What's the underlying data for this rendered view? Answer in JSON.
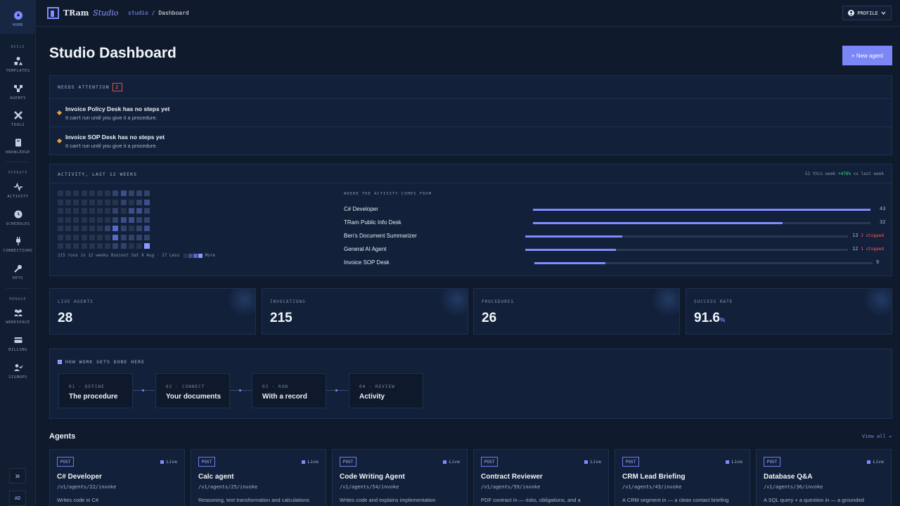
{
  "sidebar": {
    "home": "HOME",
    "groups": {
      "build": "BUILD",
      "operate": "OPERATE",
      "manage": "MANAGE"
    },
    "items": [
      "TEMPLATES",
      "AGENTS",
      "TOOLS",
      "KNOWLEDGE",
      "ACTIVITY",
      "SCHEDULES",
      "CONNECTIONS",
      "KEYS",
      "WORKSPACE",
      "BILLING",
      "SIGNUPS"
    ],
    "expand": "»",
    "avatar": "AD"
  },
  "topbar": {
    "brand_main": "TRam",
    "brand_sub": "Studio",
    "crumb_root": "studio",
    "crumb_sep": " / ",
    "crumb_current": "Dashboard",
    "profile": "PROFILE"
  },
  "page": {
    "title": "Studio Dashboard",
    "new_agent": "+ New agent"
  },
  "attention": {
    "heading": "NEEDS ATTENTION",
    "count": "2",
    "items": [
      {
        "title": "Invoice Policy Desk has no steps yet",
        "sub": "It can't run until you give it a procedure."
      },
      {
        "title": "Invoice SOP Desk has no steps yet",
        "sub": "It can't run until you give it a procedure."
      }
    ]
  },
  "activity": {
    "heading": "ACTIVITY, LAST 12 WEEKS",
    "week_summary_pre": "52 this week ",
    "week_delta": "+478%",
    "week_summary_post": " vs last week",
    "legend": "215 runs in 12 weeks   Busiest Sat 8 Aug · 27   Less",
    "legend_more": "More",
    "sources_heading": "WHERE THE ACTIVITY COMES FROM",
    "sources": [
      {
        "name": "C# Developer",
        "value": "43",
        "stopped": "",
        "fraction": 1.0
      },
      {
        "name": "TRam Public Info Desk",
        "value": "32",
        "stopped": "",
        "fraction": 0.74
      },
      {
        "name": "Ben's Document Summarizer",
        "value": "13",
        "stopped": "2 stopped",
        "fraction": 0.3
      },
      {
        "name": "General AI Agent",
        "value": "12",
        "stopped": "1 stopped",
        "fraction": 0.28
      },
      {
        "name": "Invoice SOP Desk",
        "value": "9",
        "stopped": "",
        "fraction": 0.21
      }
    ]
  },
  "stats": [
    {
      "label": "LIVE AGENTS",
      "value": "28",
      "unit": ""
    },
    {
      "label": "INVOCATIONS",
      "value": "215",
      "unit": ""
    },
    {
      "label": "PROCEDURES",
      "value": "26",
      "unit": ""
    },
    {
      "label": "SUCCESS RATE",
      "value": "91.6",
      "unit": "%"
    }
  ],
  "how": {
    "heading": "HOW WORK GETS DONE HERE",
    "steps": [
      {
        "num": "01 · DEFINE",
        "title": "The procedure"
      },
      {
        "num": "02 · CONNECT",
        "title": "Your documents"
      },
      {
        "num": "03 · RUN",
        "title": "With a record"
      },
      {
        "num": "04 · REVIEW",
        "title": "Activity"
      }
    ]
  },
  "agents": {
    "heading": "Agents",
    "view_all": "View all →",
    "method": "POST",
    "status": "Live",
    "items": [
      {
        "name": "C# Developer",
        "path": "/v1/agents/22/invoke",
        "desc": "Writes code in C#"
      },
      {
        "name": "Calc agent",
        "path": "/v1/agents/25/invoke",
        "desc": "Reasoning, text transformation and calculations"
      },
      {
        "name": "Code Writing Agent",
        "path": "/v1/agents/54/invoke",
        "desc": "Writes code and explains implementation"
      },
      {
        "name": "Contract Reviewer",
        "path": "/v1/agents/59/invoke",
        "desc": "PDF contract in — risks, obligations, and a"
      },
      {
        "name": "CRM Lead Briefing",
        "path": "/v1/agents/43/invoke",
        "desc": "A CRM segment in — a clean contact briefing"
      },
      {
        "name": "Database Q&A",
        "path": "/v1/agents/36/invoke",
        "desc": "A SQL query + a question in — a grounded"
      }
    ]
  },
  "colors": {
    "accent": "#7f8cff",
    "warning": "#e9a23b",
    "danger": "#ff5c5c",
    "positive": "#3ddc84"
  }
}
